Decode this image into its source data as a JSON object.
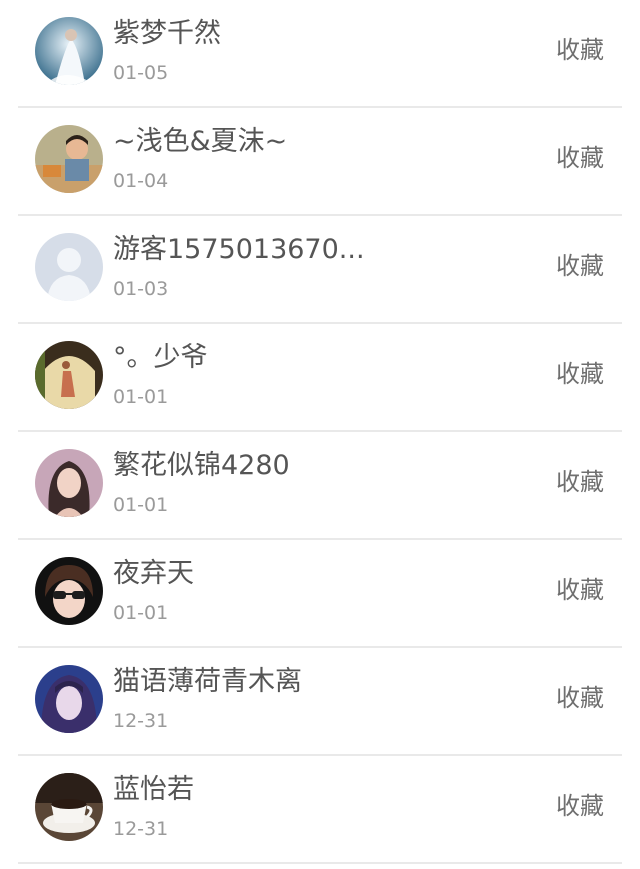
{
  "list": {
    "items": [
      {
        "name": "紫梦千然",
        "date": "01-05",
        "action": "收藏",
        "avatar": "photo-avatar"
      },
      {
        "name": "~浅色&夏沫~",
        "date": "01-04",
        "action": "收藏",
        "avatar": "photo-avatar"
      },
      {
        "name": "游客1575013670...",
        "date": "01-03",
        "action": "收藏",
        "avatar": "default-user-avatar"
      },
      {
        "name": "°。少爷",
        "date": "01-01",
        "action": "收藏",
        "avatar": "photo-avatar"
      },
      {
        "name": "繁花似锦4280",
        "date": "01-01",
        "action": "收藏",
        "avatar": "photo-avatar"
      },
      {
        "name": "夜弃天",
        "date": "01-01",
        "action": "收藏",
        "avatar": "photo-avatar"
      },
      {
        "name": "猫语薄荷青木离",
        "date": "12-31",
        "action": "收藏",
        "avatar": "photo-avatar"
      },
      {
        "name": "蓝怡若",
        "date": "12-31",
        "action": "收藏",
        "avatar": "photo-avatar"
      }
    ]
  },
  "colors": {
    "name_text": "#555555",
    "date_text": "#9a9a9a",
    "action_text": "#6f6f6f",
    "divider": "#e9e9e9"
  }
}
